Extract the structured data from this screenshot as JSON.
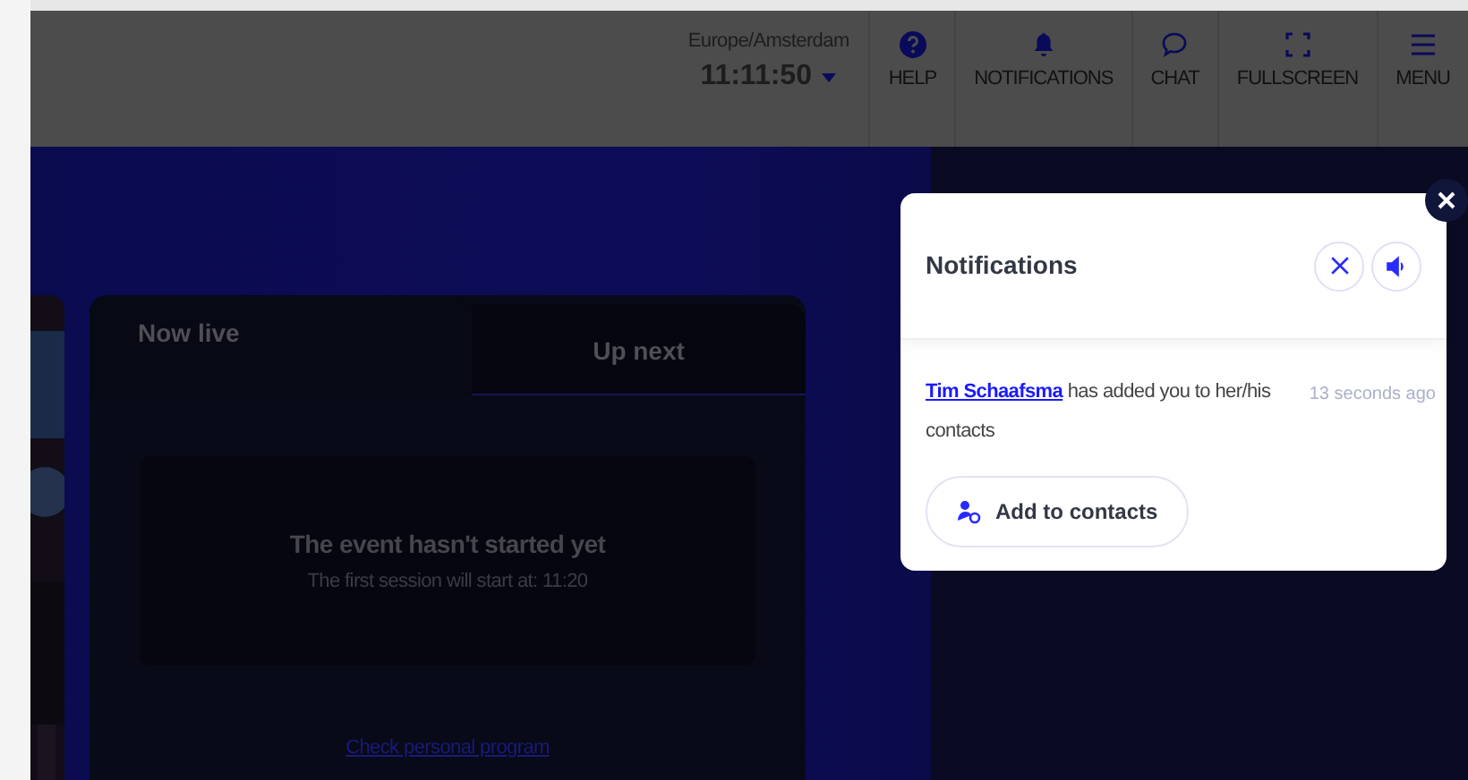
{
  "header": {
    "timezone": "Europe/Amsterdam",
    "time": "11:11:50",
    "nav": [
      {
        "label": "HELP",
        "kind": "help"
      },
      {
        "label": "NOTIFICATIONS",
        "kind": "notifications"
      },
      {
        "label": "CHAT",
        "kind": "chat"
      },
      {
        "label": "FULLSCREEN",
        "kind": "fullscreen"
      },
      {
        "label": "MENU",
        "kind": "menu"
      }
    ]
  },
  "schedule": {
    "tabs": [
      {
        "label": "Now live",
        "selected": true
      },
      {
        "label": "Up next",
        "selected": false
      }
    ],
    "empty_title": "The event hasn't started yet",
    "empty_text": "The first session will start at: 11:20",
    "link": "Check personal program"
  },
  "notifications": {
    "title": "Notifications",
    "items": [
      {
        "name": "Tim Schaafsma",
        "text": " has added you to her/his contacts",
        "time": "13 seconds ago",
        "action": "Add to contacts"
      }
    ]
  }
}
